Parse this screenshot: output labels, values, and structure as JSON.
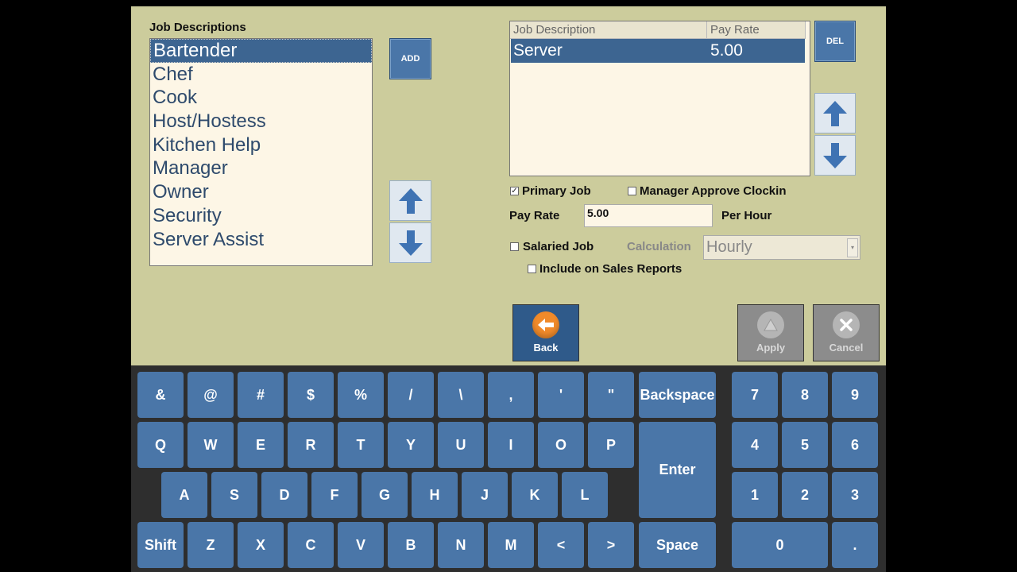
{
  "left": {
    "label": "Job Descriptions",
    "items": [
      "Bartender",
      "Chef",
      "Cook",
      "Host/Hostess",
      "Kitchen Help",
      "Manager",
      "Owner",
      "Security",
      "Server Assist"
    ],
    "add_label": "ADD"
  },
  "grid": {
    "col_job": "Job Description",
    "col_rate": "Pay Rate",
    "rows": [
      {
        "job": "Server",
        "rate": "5.00"
      }
    ],
    "del_label": "DEL"
  },
  "form": {
    "primary_job_label": "Primary Job",
    "primary_job_checked": true,
    "manager_approve_label": "Manager Approve Clockin",
    "manager_approve_checked": false,
    "pay_rate_label": "Pay Rate",
    "pay_rate_value": "5.00",
    "per_hour_label": "Per Hour",
    "salaried_label": "Salaried Job",
    "salaried_checked": false,
    "calculation_label": "Calculation",
    "calculation_value": "Hourly",
    "include_sales_label": "Include on Sales Reports",
    "include_sales_checked": false
  },
  "commands": {
    "back": "Back",
    "apply": "Apply",
    "cancel": "Cancel"
  },
  "keyboard": {
    "row1": [
      "&",
      "@",
      "#",
      "$",
      "%",
      "/",
      "\\",
      ",",
      "'",
      "\""
    ],
    "row2": [
      "Q",
      "W",
      "E",
      "R",
      "T",
      "Y",
      "U",
      "I",
      "O",
      "P"
    ],
    "row3": [
      "A",
      "S",
      "D",
      "F",
      "G",
      "H",
      "J",
      "K",
      "L"
    ],
    "row4": [
      "Z",
      "X",
      "C",
      "V",
      "B",
      "N",
      "M",
      "<",
      ">"
    ],
    "backspace": "Backspace",
    "enter": "Enter",
    "shift": "Shift",
    "space": "Space",
    "numpad": [
      "7",
      "8",
      "9",
      "4",
      "5",
      "6",
      "1",
      "2",
      "3"
    ],
    "zero": "0",
    "dot": "."
  },
  "colors": {
    "panel_bg": "#cccc9c",
    "key_blue": "#4a76a8",
    "selection": "#3d6591",
    "list_bg": "#fdf6e6",
    "back_icon": "#f08a2a"
  }
}
